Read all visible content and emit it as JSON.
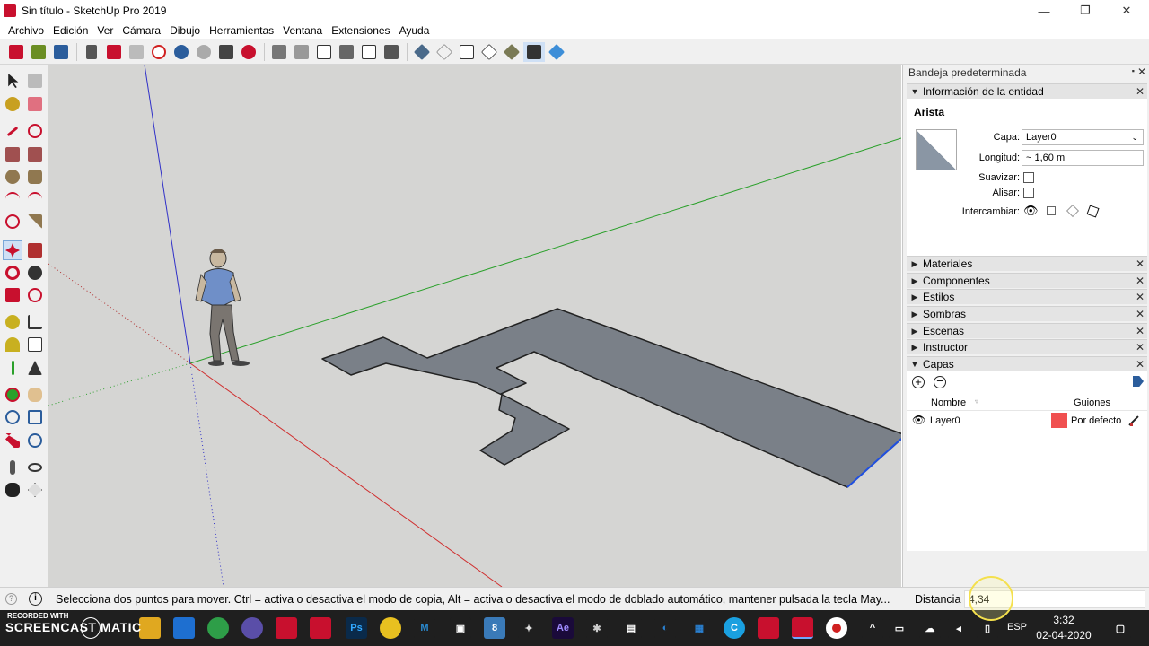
{
  "window": {
    "title": "Sin título - SketchUp Pro 2019",
    "minimize": "—",
    "maximize": "❐",
    "close": "✕"
  },
  "menu": [
    "Archivo",
    "Edición",
    "Ver",
    "Cámara",
    "Dibujo",
    "Herramientas",
    "Ventana",
    "Extensiones",
    "Ayuda"
  ],
  "tray": {
    "title": "Bandeja predeterminada",
    "entity_info": {
      "header": "Información de la entidad",
      "entity_type": "Arista",
      "layer_label": "Capa:",
      "layer_value": "Layer0",
      "length_label": "Longitud:",
      "length_value": "~ 1,60 m",
      "soften_label": "Suavizar:",
      "smooth_label": "Alisar:",
      "toggle_label": "Intercambiar:"
    },
    "panels": [
      "Materiales",
      "Componentes",
      "Estilos",
      "Sombras",
      "Escenas",
      "Instructor"
    ],
    "layers": {
      "header": "Capas",
      "col_name": "Nombre",
      "col_dashes": "Guiones",
      "rows": [
        {
          "name": "Layer0",
          "dash": "Por defecto",
          "color": "#f05050"
        }
      ]
    }
  },
  "status": {
    "message": "Selecciona dos puntos para mover. Ctrl = activa o desactiva el modo de copia, Alt = activa o desactiva el modo de doblado automático, mantener pulsada la tecla May...",
    "measure_label": "Distancia",
    "measure_value": "4,34"
  },
  "taskbar": {
    "recorder_line1": "RECORDED WITH",
    "recorder_line2": "SCREENCAST  MATIC",
    "language": "ESP",
    "time": "3:32",
    "date": "02-04-2020"
  },
  "colors": {
    "viewport_bg": "#d5d5d3",
    "face": "#7a8088",
    "axis_red": "#d03030",
    "axis_green": "#2aa02a",
    "axis_blue": "#3030c8"
  }
}
